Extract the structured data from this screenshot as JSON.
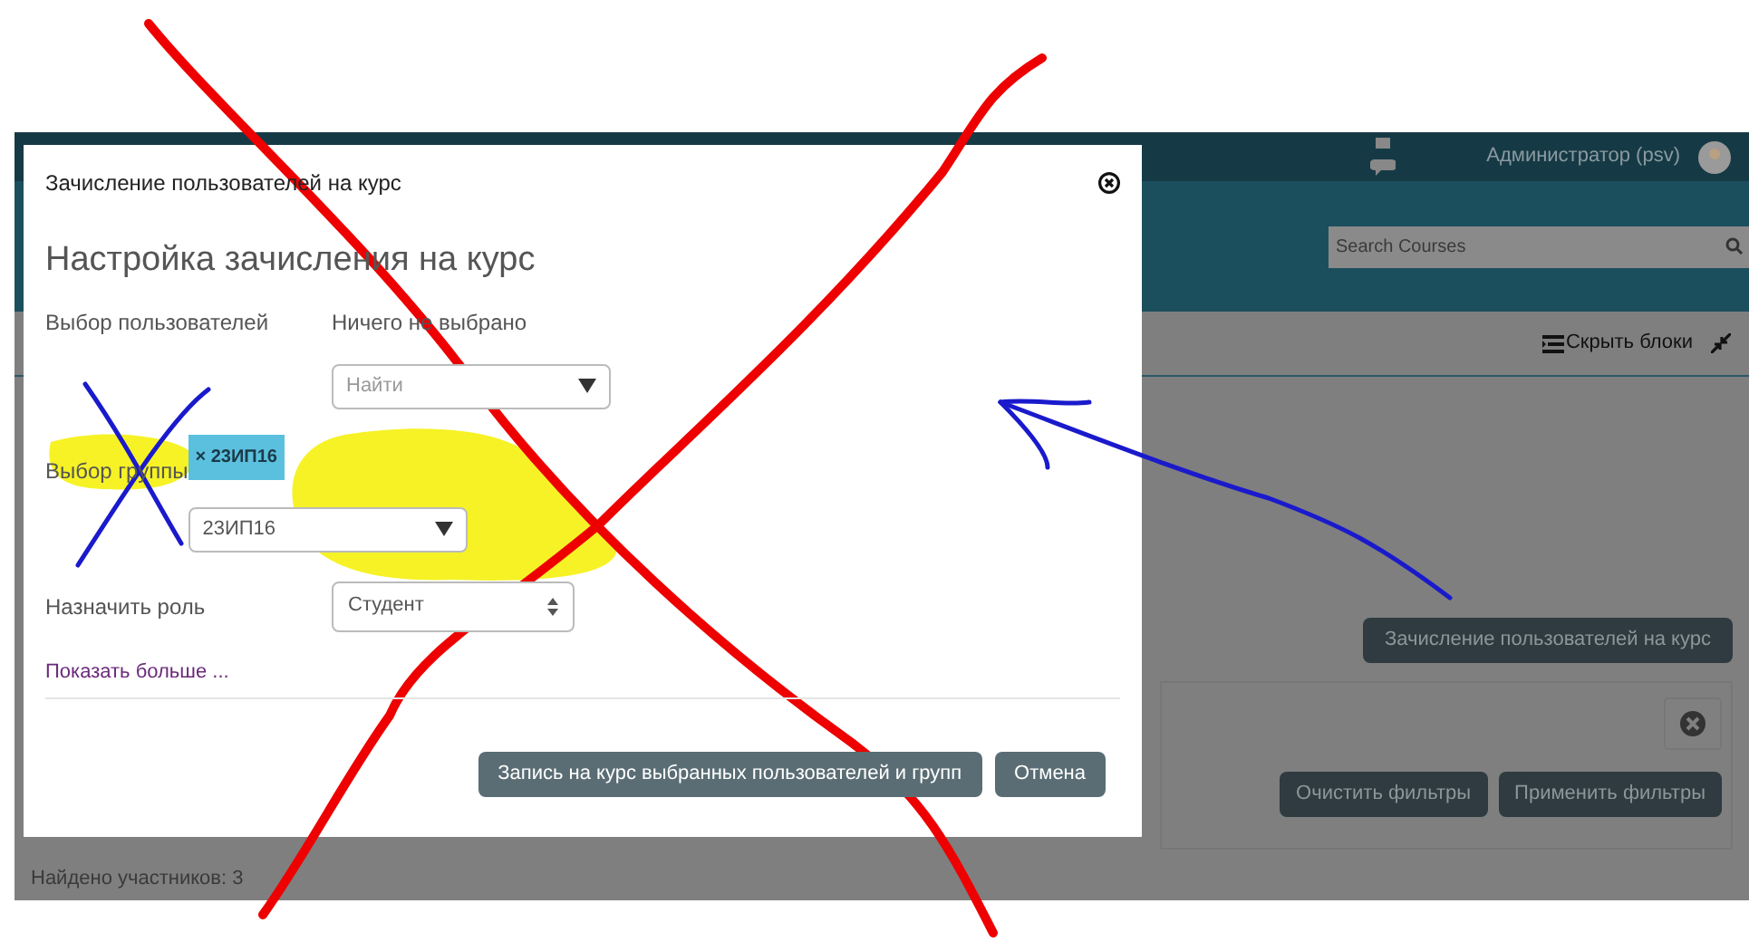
{
  "navbar": {
    "user": "Администратор (psv)"
  },
  "header": {
    "search": {
      "placeholder": "Search Courses"
    }
  },
  "toolbar": {
    "hide_blocks": "Скрыть блоки"
  },
  "page": {
    "enrol_button": "Зачисление пользователей на курс",
    "filter_buttons": [
      "Очистить фильтры",
      "Применить фильтры"
    ],
    "found": "Найдено участников: 3"
  },
  "dialog": {
    "title": "Зачисление пользователей на курс",
    "heading": "Настройка зачисления на курс",
    "rows": [
      {
        "kind": "users",
        "label": "Выбор пользователей",
        "note": "Ничего не выбрано",
        "select": "Найти"
      },
      {
        "kind": "group",
        "label": "Выбор группы",
        "tag": "× 23ИП16",
        "select": "23ИП16"
      },
      {
        "kind": "role",
        "label": "Назначить роль",
        "select": "Студент"
      }
    ],
    "more_link": "Показать больше ...",
    "buttons": [
      {
        "label": "Запись на курс выбранных пользователей и групп"
      },
      {
        "label": "Отмена"
      }
    ]
  }
}
